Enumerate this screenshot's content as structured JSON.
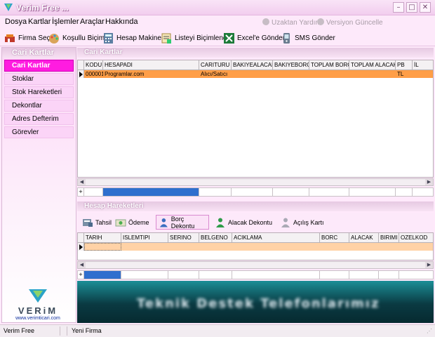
{
  "window": {
    "title": "Verim Free ...",
    "controls": [
      "minimize",
      "maximize",
      "close"
    ]
  },
  "menu": {
    "items": [
      "Dosya",
      "Kartlar",
      "İşlemler",
      "Araçlar",
      "Hakkında"
    ],
    "remote_support": "Uzaktan Yardım",
    "version_update": "Versiyon Güncelle"
  },
  "toolbar": {
    "buttons": [
      {
        "label": "Firma Seç",
        "icon": "company-icon"
      },
      {
        "label": "Koşullu Biçim",
        "icon": "palette-icon"
      },
      {
        "label": "Hesap Makinesi",
        "icon": "calculator-icon"
      },
      {
        "label": "Listeyi Biçimlendir",
        "icon": "list-format-icon"
      },
      {
        "label": "Excel'e Gönder",
        "icon": "excel-icon"
      },
      {
        "label": "SMS Gönder",
        "icon": "phone-icon"
      }
    ]
  },
  "sidebar": {
    "header": "Cari Kartlar",
    "items": [
      "Cari Kartlar",
      "Stoklar",
      "Stok Hareketleri",
      "Dekontlar",
      "Adres Defterim",
      "Görevler"
    ],
    "active_index": 0,
    "logo_text": "VERiM",
    "logo_url": "www.verimticari.com"
  },
  "accounts_panel": {
    "header": "Cari Kartlar",
    "columns": [
      "KODU",
      "HESAPADI",
      "CARITURU",
      "BAKIYEALACAK",
      "BAKIYEBORC",
      "TOPLAM BORC",
      "TOPLAM ALACAK",
      "PB",
      "İL"
    ],
    "rows": [
      {
        "KODU": "000001",
        "HESAPADI": "Programlar.com",
        "CARITURU": "Alıcı/Satıcı",
        "PB": "TL"
      }
    ],
    "selected_row_color": "#ff9e47"
  },
  "movements_panel": {
    "header": "Hesap Hareketleri",
    "buttons": [
      {
        "label": "Tahsil",
        "icon": "collection-icon"
      },
      {
        "label": "Ödeme",
        "icon": "payment-icon"
      },
      {
        "label": "Borç Dekontu",
        "icon": "user-blue-icon",
        "selected": true
      },
      {
        "label": "Alacak Dekontu",
        "icon": "user-green-icon"
      },
      {
        "label": "Açılış Kartı",
        "icon": "user-grey-icon"
      }
    ],
    "columns": [
      "TARIH",
      "ISLEMTIPI",
      "SERINO",
      "BELGENO",
      "ACIKLAMA",
      "BORC",
      "ALACAK",
      "BIRIMI",
      "OZELKOD"
    ],
    "row_color": "#ffd2a6"
  },
  "banner": {
    "text": "Teknik Destek Telefonlarımız"
  },
  "status": {
    "left": "Verim Free",
    "firm": "Yeni Firma"
  },
  "colors": {
    "accent": "#ff1ce0",
    "selection": "#ff9e47",
    "scroll_thumb": "#2f6fce"
  }
}
